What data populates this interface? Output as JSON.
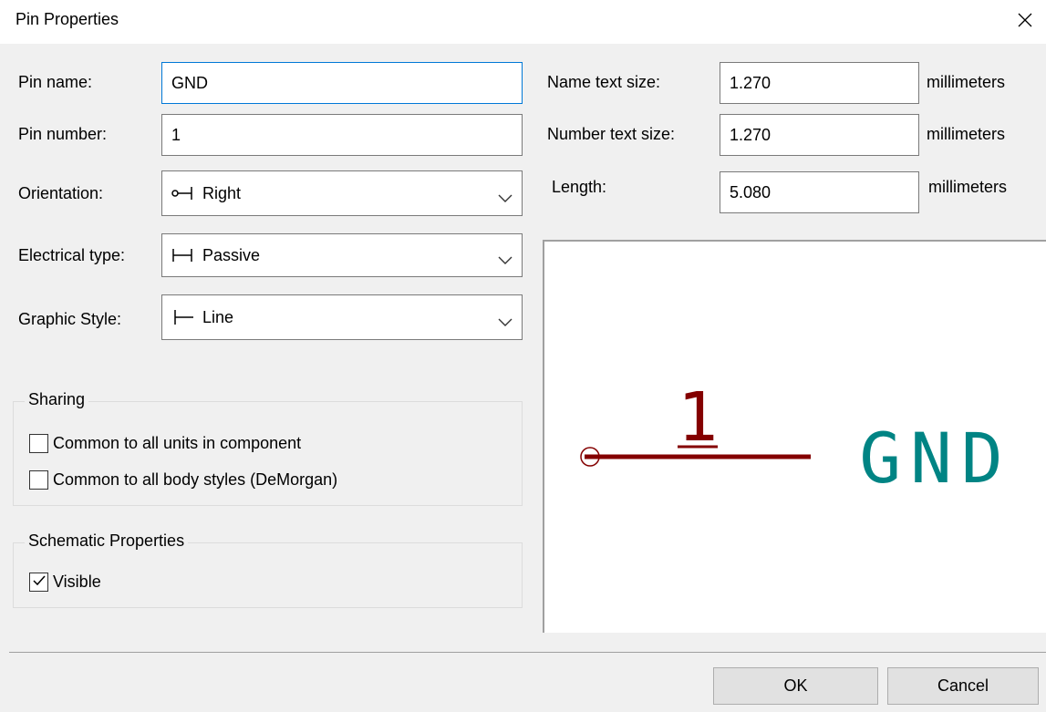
{
  "window": {
    "title": "Pin Properties",
    "close_icon": "close-icon"
  },
  "fields": {
    "pin_name_label": "Pin name:",
    "pin_name_value": "GND",
    "pin_number_label": "Pin number:",
    "pin_number_value": "1",
    "orientation_label": "Orientation:",
    "orientation_value": "Right",
    "orientation_icon": "pin-right-icon",
    "electrical_type_label": "Electrical type:",
    "electrical_type_value": "Passive",
    "electrical_type_icon": "passive-icon",
    "graphic_style_label": "Graphic Style:",
    "graphic_style_value": "Line",
    "graphic_style_icon": "line-style-icon"
  },
  "sizes": {
    "name_text_size_label": "Name text size:",
    "name_text_size_value": "1.270",
    "name_text_size_unit": "millimeters",
    "number_text_size_label": "Number text size:",
    "number_text_size_value": "1.270",
    "number_text_size_unit": "millimeters",
    "length_label": "Length:",
    "length_value": "5.080",
    "length_unit": "millimeters"
  },
  "sharing": {
    "title": "Sharing",
    "common_units_label": "Common to all units in component",
    "common_units_checked": false,
    "common_body_label": "Common to all body styles (DeMorgan)",
    "common_body_checked": false
  },
  "schematic": {
    "title": "Schematic Properties",
    "visible_label": "Visible",
    "visible_checked": true
  },
  "preview": {
    "pin_number": "1",
    "pin_name": "GND",
    "pin_color": "#840000",
    "name_color": "#008484"
  },
  "buttons": {
    "ok_label": "OK",
    "cancel_label": "Cancel"
  }
}
